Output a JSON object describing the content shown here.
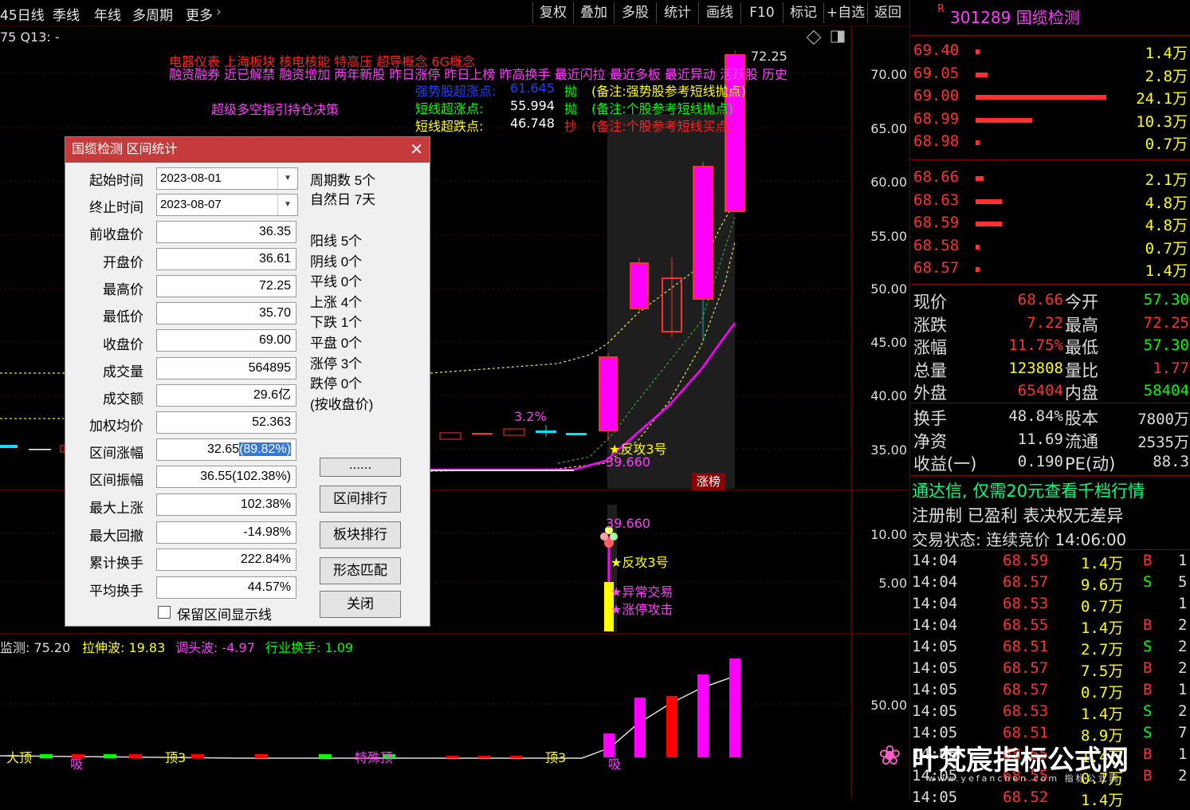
{
  "toolbar": {
    "left_items": [
      "45日线",
      "季线",
      "年线",
      "多周期",
      "更多"
    ],
    "right_buttons": [
      "复权",
      "叠加",
      "多股",
      "统计",
      "画线",
      "F10",
      "标记",
      "+自选",
      "返回"
    ]
  },
  "chart_header": {
    "indicator": "75 Q13: -",
    "concepts_line1": "电器仪表  上海板块  核电核能 特高压 超导概念 6G概念",
    "concepts_line2": "融资融券 近已解禁 融资增加 两年新股 昨日涨停 昨日上榜 昨高换手 最近闪拉 最近多板 最近异动 活跃股 历史",
    "signal_label": "超级多空指引持仓决策",
    "lines": [
      {
        "label": "强势股超涨点:",
        "value": "61.645",
        "tag": "抛",
        "note": "(备注:强势股参考短线抛点)"
      },
      {
        "label": "短线超涨点:",
        "value": "55.994",
        "tag": "抛",
        "note": "(备注:个股参考短线抛点)"
      },
      {
        "label": "短线超跌点:",
        "value": "46.748",
        "tag": "抄",
        "note": "(备注:个股参考短线买点)"
      }
    ],
    "peak_label": "72.25",
    "pct_label": "3.2%",
    "fangong": "★反攻3号",
    "low_label": "39.660",
    "zhangbang": "涨榜"
  },
  "price_axis": [
    "70.00",
    "65.00",
    "60.00",
    "55.00",
    "50.00",
    "45.00",
    "40.00",
    "35.00"
  ],
  "vol_axis": [
    "10.00",
    "5.00"
  ],
  "vol_labels": {
    "value": "39.660",
    "fangong": "★反攻3号",
    "yichang": "★异常交易",
    "zhangting": "★涨停攻击"
  },
  "bottom_header": {
    "a": "监测: 75.20",
    "b": "拉伸波: 19.83",
    "c": "调头波: -4.97",
    "d": "行业换手: 1.09"
  },
  "bottom_axis": "50.00",
  "bottom_tags": [
    "大顶",
    "吸",
    "顶3",
    "特殊顶",
    "顶3",
    "吸"
  ],
  "dialog": {
    "title": "国缆检测 区间统计",
    "start_label": "起始时间",
    "start_value": "2023-08-01",
    "end_label": "终止时间",
    "end_value": "2023-08-07",
    "fields": [
      {
        "label": "前收盘价",
        "value": "36.35"
      },
      {
        "label": "开盘价",
        "value": "36.61"
      },
      {
        "label": "最高价",
        "value": "72.25"
      },
      {
        "label": "最低价",
        "value": "35.70"
      },
      {
        "label": "收盘价",
        "value": "69.00"
      },
      {
        "label": "成交量",
        "value": "564895"
      },
      {
        "label": "成交额",
        "value": "29.6亿"
      },
      {
        "label": "加权均价",
        "value": "52.363"
      },
      {
        "label": "区间涨幅",
        "value": "32.65",
        "highlight": "(89.82%)"
      },
      {
        "label": "区间振幅",
        "value": "36.55(102.38%)"
      },
      {
        "label": "最大上涨",
        "value": "102.38%"
      },
      {
        "label": "最大回撤",
        "value": "-14.98%"
      },
      {
        "label": "累计换手",
        "value": "222.84%"
      },
      {
        "label": "平均换手",
        "value": "44.57%"
      }
    ],
    "period_count": "周期数 5个",
    "natural_days": "自然日 7天",
    "stats": [
      "阳线 5个",
      "阴线 0个",
      "平线 0个",
      "上涨 4个",
      "下跌 1个",
      "平盘 0个",
      "涨停 3个",
      "跌停 0个",
      "(按收盘价)"
    ],
    "buttons": [
      "......",
      "区间排行",
      "板块排行",
      "形态匹配",
      "关闭"
    ],
    "checkbox_label": "保留区间显示线",
    "checkbox_checked": false
  },
  "quote": {
    "code": "R",
    "title": "301289 国缆检测",
    "asks": [
      {
        "price": "69.40",
        "vol": "1.4万",
        "bar": 0.03
      },
      {
        "price": "69.05",
        "vol": "2.8万",
        "bar": 0.09
      },
      {
        "price": "69.00",
        "vol": "24.1万",
        "bar": 1.0
      },
      {
        "price": "68.99",
        "vol": "10.3万",
        "bar": 0.43
      },
      {
        "price": "68.98",
        "vol": "0.7万",
        "bar": 0.02
      }
    ],
    "bids": [
      {
        "price": "68.66",
        "vol": "2.1万",
        "bar": 0.06
      },
      {
        "price": "68.63",
        "vol": "4.8万",
        "bar": 0.2
      },
      {
        "price": "68.59",
        "vol": "4.8万",
        "bar": 0.2
      },
      {
        "price": "68.58",
        "vol": "0.7万",
        "bar": 0.02
      },
      {
        "price": "68.57",
        "vol": "1.4万",
        "bar": 0.03
      }
    ],
    "stats": [
      {
        "l1": "现价",
        "v1": "68.66",
        "l2": "今开",
        "v2": "57.30"
      },
      {
        "l1": "涨跌",
        "v1": "7.22",
        "l2": "最高",
        "v2": "72.25"
      },
      {
        "l1": "涨幅",
        "v1": "11.75%",
        "l2": "最低",
        "v2": "57.30"
      },
      {
        "l1": "总量",
        "v1": "123808",
        "l2": "量比",
        "v2": "1.77"
      },
      {
        "l1": "外盘",
        "v1": "65404",
        "l2": "内盘",
        "v2": "58404"
      }
    ],
    "stats2": [
      {
        "l1": "换手",
        "v1": "48.84%",
        "l2": "股本",
        "v2": "7800万"
      },
      {
        "l1": "净资",
        "v1": "11.69",
        "l2": "流通",
        "v2": "2535万"
      },
      {
        "l1": "收益(一)",
        "v1": "0.190",
        "l2": "PE(动)",
        "v2": "88.3"
      }
    ],
    "ad": "通达信, 仅需20元查看千档行情",
    "note": "注册制 已盈利 表决权无差异",
    "trade_status": "交易状态: 连续竞价 14:06:00",
    "trades": [
      {
        "t": "14:04",
        "p": "68.59",
        "v": "1.4万",
        "bs": "B",
        "n": "1"
      },
      {
        "t": "14:04",
        "p": "68.57",
        "v": "9.6万",
        "bs": "S",
        "n": "5"
      },
      {
        "t": "14:04",
        "p": "68.53",
        "v": "0.7万",
        "bs": "",
        "n": "1"
      },
      {
        "t": "14:04",
        "p": "68.55",
        "v": "1.4万",
        "bs": "B",
        "n": "2"
      },
      {
        "t": "14:05",
        "p": "68.51",
        "v": "2.7万",
        "bs": "S",
        "n": "2"
      },
      {
        "t": "14:05",
        "p": "68.57",
        "v": "7.5万",
        "bs": "B",
        "n": "2"
      },
      {
        "t": "14:05",
        "p": "68.57",
        "v": "0.7万",
        "bs": "B",
        "n": "1"
      },
      {
        "t": "14:05",
        "p": "68.53",
        "v": "1.4万",
        "bs": "S",
        "n": "2"
      },
      {
        "t": "14:05",
        "p": "68.51",
        "v": "8.9万",
        "bs": "S",
        "n": "7"
      },
      {
        "t": "14:05",
        "p": "68.55",
        "v": "1.4万",
        "bs": "B",
        "n": "1"
      },
      {
        "t": "14:05",
        "p": "68.55",
        "v": "0.7万",
        "bs": "B",
        "n": "2"
      },
      {
        "t": "14:05",
        "p": "68.52",
        "v": "1.4万",
        "bs": "",
        "n": ""
      }
    ]
  },
  "watermark": {
    "text": "叶梵宸指标公式网",
    "url": "www.yefanchen.com 指标公式网"
  }
}
